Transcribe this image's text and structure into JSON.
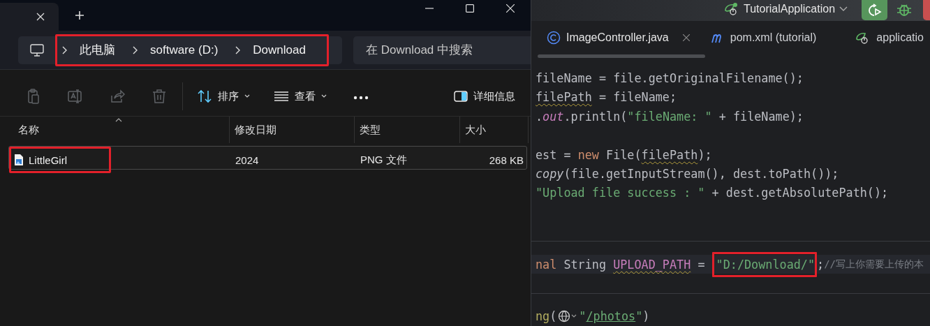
{
  "explorer": {
    "breadcrumb": {
      "highlighted": true,
      "items": [
        "此电脑",
        "software (D:)",
        "Download"
      ]
    },
    "search": {
      "placeholder": "在 Download 中搜索"
    },
    "actions": [
      {
        "kind": "paste",
        "disabled": true
      },
      {
        "kind": "rename",
        "disabled": true
      },
      {
        "kind": "share",
        "disabled": true
      },
      {
        "kind": "delete",
        "disabled": true
      },
      {
        "kind": "sort",
        "label": "排序"
      },
      {
        "kind": "view",
        "label": "查看"
      },
      {
        "kind": "more"
      },
      {
        "kind": "details",
        "label": "详细信息"
      }
    ],
    "columns": [
      {
        "label": "名称",
        "sorted": true
      },
      {
        "label": "修改日期",
        "sorted": false
      },
      {
        "label": "类型",
        "sorted": false
      },
      {
        "label": "大小",
        "sorted": false
      }
    ],
    "files": [
      {
        "name": "LittleGirl",
        "date": "2024",
        "type": "PNG 文件",
        "size": "268 KB",
        "selected": true,
        "highlighted": true
      }
    ]
  },
  "ide": {
    "run_config": "TutorialApplication",
    "tabs": [
      {
        "label": "ImageController.java",
        "kind": "class",
        "selected": true
      },
      {
        "label": "pom.xml (tutorial)",
        "kind": "maven",
        "selected": false
      },
      {
        "label": "applicatio",
        "kind": "spring",
        "selected": false
      }
    ],
    "code": [
      {
        "kind": "code",
        "tokens": [
          {
            "kind": "plain",
            "text": "fileName = file.getOriginalFilename();"
          }
        ]
      },
      {
        "kind": "code",
        "tokens": [
          {
            "kind": "plain",
            "text": "filePath",
            "warning": true
          },
          {
            "kind": "plain",
            "text": " = fileName;"
          }
        ]
      },
      {
        "kind": "code",
        "tokens": [
          {
            "kind": "plain",
            "text": "."
          },
          {
            "kind": "static",
            "text": "out"
          },
          {
            "kind": "plain",
            "text": ".println("
          },
          {
            "kind": "string",
            "text": "\"fileName: \""
          },
          {
            "kind": "plain",
            "text": " + fileName);"
          }
        ]
      },
      {
        "kind": "blank"
      },
      {
        "kind": "code",
        "tokens": [
          {
            "kind": "plain",
            "text": "est = "
          },
          {
            "kind": "keyword",
            "text": "new"
          },
          {
            "kind": "plain",
            "text": " File("
          },
          {
            "kind": "plain",
            "text": "filePath",
            "warning": true
          },
          {
            "kind": "plain",
            "text": ");"
          }
        ]
      },
      {
        "kind": "code",
        "tokens": [
          {
            "kind": "method",
            "text": "copy"
          },
          {
            "kind": "plain",
            "text": "(file.getInputStream(), dest.toPath());"
          }
        ]
      },
      {
        "kind": "code",
        "tokens": [
          {
            "kind": "string",
            "text": "\"Upload file success : \""
          },
          {
            "kind": "plain",
            "text": " + dest.getAbsolutePath();"
          }
        ]
      },
      {
        "kind": "blank"
      },
      {
        "kind": "blank"
      },
      {
        "kind": "separator"
      },
      {
        "kind": "code",
        "current": true,
        "tokens": [
          {
            "kind": "keyword",
            "text": "nal"
          },
          {
            "kind": "plain",
            "text": " String "
          },
          {
            "kind": "field",
            "text": "UPLOAD_PATH",
            "warning": true
          },
          {
            "kind": "plain",
            "text": " = "
          },
          {
            "kind": "string",
            "text": "\"D:/Download/\"",
            "highlighted": true
          },
          {
            "kind": "plain",
            "text": ";"
          },
          {
            "kind": "comment",
            "text": "//写上你需要上传的本"
          }
        ]
      },
      {
        "kind": "blank"
      },
      {
        "kind": "separator"
      },
      {
        "kind": "code",
        "tokens": [
          {
            "kind": "annotation",
            "text": "ng"
          },
          {
            "kind": "plain",
            "text": "("
          },
          {
            "kind": "globe"
          },
          {
            "kind": "string",
            "text": "\""
          },
          {
            "kind": "url",
            "text": "/photos"
          },
          {
            "kind": "string",
            "text": "\""
          },
          {
            "kind": "plain",
            "text": ")"
          }
        ]
      }
    ]
  }
}
